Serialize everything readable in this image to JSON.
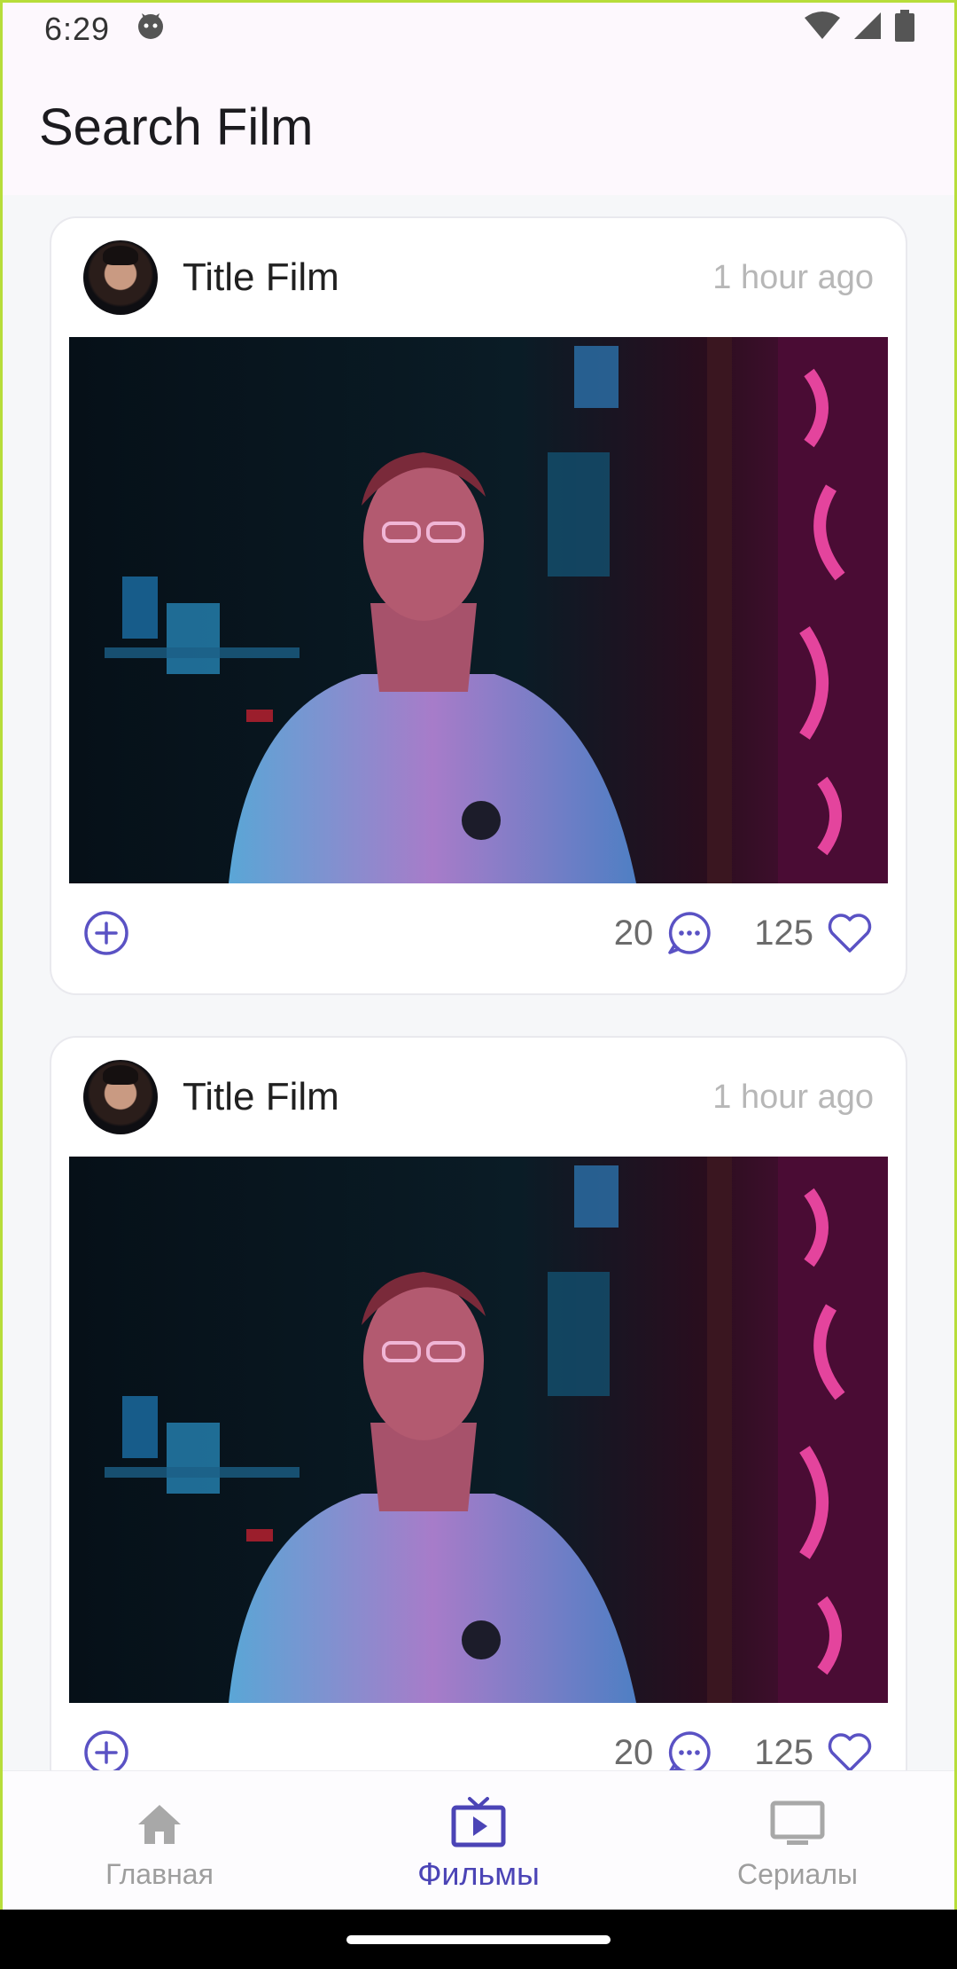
{
  "status_bar": {
    "time": "6:29"
  },
  "app_bar": {
    "title": "Search Film"
  },
  "cards": [
    {
      "title": "Title Film",
      "time": "1 hour ago",
      "comments": "20",
      "likes": "125"
    },
    {
      "title": "Title Film",
      "time": "1 hour ago",
      "comments": "20",
      "likes": "125"
    }
  ],
  "bottom_nav": {
    "items": [
      {
        "label": "Главная",
        "icon": "home-icon",
        "active": false
      },
      {
        "label": "Фильмы",
        "icon": "tv-play-icon",
        "active": true
      },
      {
        "label": "Сериалы",
        "icon": "monitor-icon",
        "active": false
      }
    ]
  },
  "colors": {
    "accent": "#4b44b6",
    "appbar_bg": "#fdf8fd",
    "muted_text": "#b7b7b7"
  }
}
